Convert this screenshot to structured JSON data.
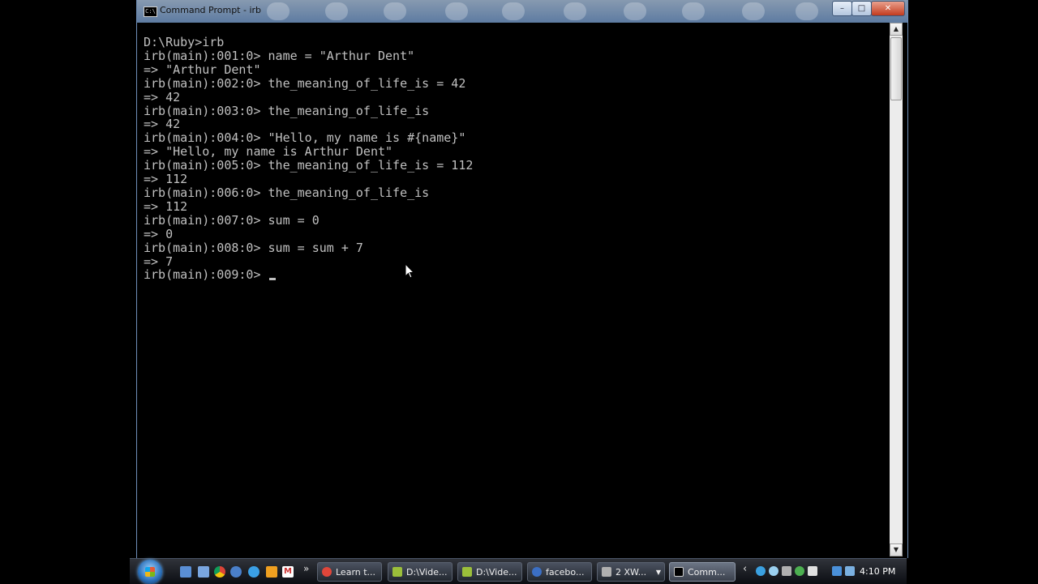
{
  "window": {
    "title": "Command Prompt - irb",
    "controls": {
      "minimize": "–",
      "maximize": "□",
      "close": "✕"
    }
  },
  "console": {
    "lines": [
      "D:\\Ruby>irb",
      "irb(main):001:0> name = \"Arthur Dent\"",
      "=> \"Arthur Dent\"",
      "irb(main):002:0> the_meaning_of_life_is = 42",
      "=> 42",
      "irb(main):003:0> the_meaning_of_life_is",
      "=> 42",
      "irb(main):004:0> \"Hello, my name is #{name}\"",
      "=> \"Hello, my name is Arthur Dent\"",
      "irb(main):005:0> the_meaning_of_life_is = 112",
      "=> 112",
      "irb(main):006:0> the_meaning_of_life_is",
      "=> 112",
      "irb(main):007:0> sum = 0",
      "=> 0",
      "irb(main):008:0> sum = sum + 7",
      "=> 7"
    ],
    "prompt": "irb(main):009:0> "
  },
  "scrollbar": {
    "up": "▲",
    "down": "▼"
  },
  "taskbar": {
    "quicklaunch_more": "»",
    "tasks": [
      {
        "label": "Learn t...",
        "icon": "chrome-icon",
        "color": "#e0463a"
      },
      {
        "label": "D:\\Vide...",
        "icon": "folder-icon",
        "color": "#9bbf3a"
      },
      {
        "label": "D:\\Vide...",
        "icon": "folder-icon",
        "color": "#9bbf3a"
      },
      {
        "label": "facebo...",
        "icon": "browser-icon",
        "color": "#3b6fc4"
      },
      {
        "label": "2 XW...",
        "icon": "xwin-icon",
        "color": "#b0b0b0"
      },
      {
        "label": "Comm...",
        "icon": "console-icon",
        "color": "#000000"
      }
    ],
    "tray_chevron": "‹",
    "clock": "4:10 PM"
  },
  "colors": {
    "console_text": "#c0c0c0",
    "console_bg": "#000000"
  }
}
